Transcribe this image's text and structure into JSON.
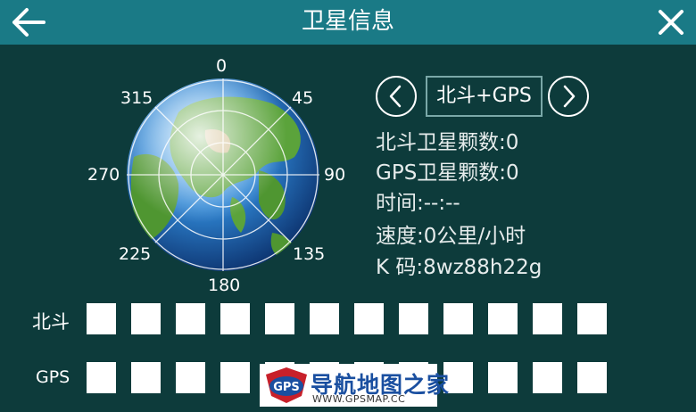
{
  "header": {
    "title": "卫星信息"
  },
  "compass": {
    "n": "0",
    "ne": "45",
    "e": "90",
    "se": "135",
    "s": "180",
    "sw": "225",
    "w": "270",
    "nw": "315"
  },
  "selector": {
    "mode": "北斗+GPS"
  },
  "info": {
    "beidou_count": "北斗卫星颗数:0",
    "gps_count": "GPS卫星颗数:0",
    "time": "时间:--:--",
    "speed": "速度:0公里/小时",
    "k_code": "K 码:8wz88h22g"
  },
  "rows": {
    "beidou_label": "北斗",
    "gps_label": "GPS"
  },
  "watermark": {
    "name": "导航地图之家",
    "url": "WWW.GPSMAP.CC",
    "badge": "GPS"
  },
  "colors": {
    "header": "#1a7a86",
    "background": "#0d3b3b",
    "ocean": "#1f6fb8",
    "land": "#5aa23a"
  }
}
